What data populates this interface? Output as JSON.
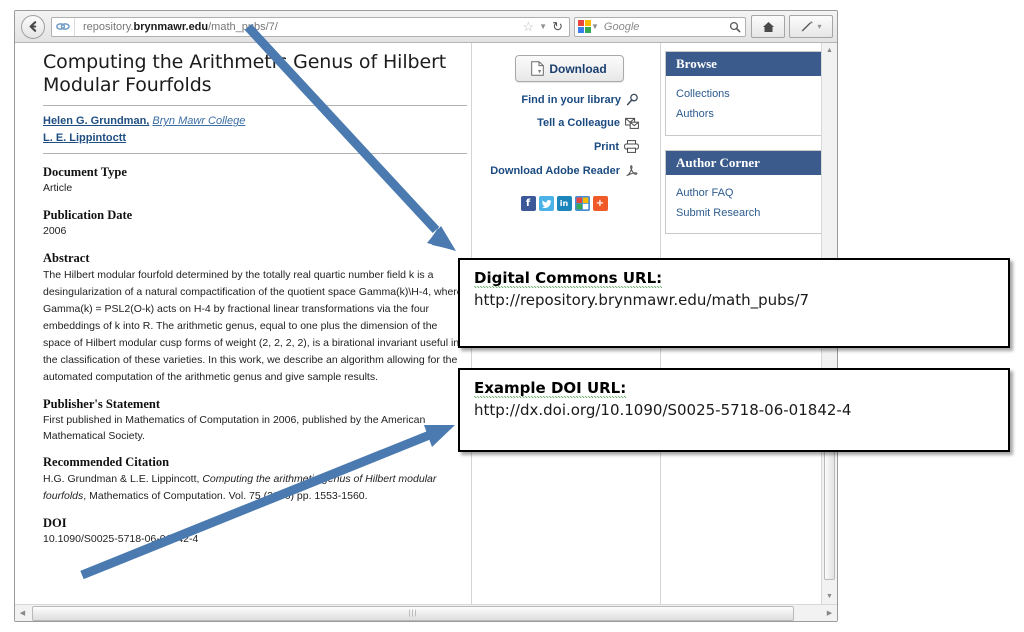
{
  "browser": {
    "url_prefix": "repository.",
    "url_domain": "brynmawr.edu",
    "url_path": "/math_pubs/7/",
    "back_icon": "back-arrow-icon",
    "site_icon": "link-icon",
    "bookmark_icon": "star-icon",
    "dropdown_icon": "chevron-down-icon",
    "reload_icon": "reload-icon",
    "search_engine": "Google",
    "search_placeholder": "Google",
    "search_icon": "magnifier-icon",
    "home_icon": "home-icon",
    "customize_icon": "pencil-icon",
    "split_caret": "▾"
  },
  "article": {
    "title": "Computing the Arithmetic Genus of Hilbert Modular Fourfolds",
    "authors": [
      {
        "name": "Helen G. Grundman,",
        "affiliation": "Bryn Mawr College"
      },
      {
        "name": "L. E. Lippintoctt",
        "affiliation": ""
      }
    ],
    "fields": [
      {
        "label": "Document Type",
        "value": "Article"
      },
      {
        "label": "Publication Date",
        "value": "2006"
      }
    ],
    "abstract_label": "Abstract",
    "abstract": "The Hilbert modular fourfold determined by the totally real quartic number field k is a desingularization of a natural compactification of the quotient space Gamma(k)\\H-4, where Gamma(k) = PSL2(O-k) acts on H-4 by fractional linear transformations via the four embeddings of k into R. The arithmetic genus, equal to one plus the dimension of the space of Hilbert modular cusp forms of weight (2, 2, 2, 2), is a birational invariant useful in the classification of these varieties. In this work, we describe an algorithm allowing for the automated computation of the arithmetic genus and give sample results.",
    "publisher_label": "Publisher's Statement",
    "publisher_statement": "First published in Mathematics of Computation in 2006, published by the American Mathematical Society.",
    "citation_label": "Recommended Citation",
    "citation_part1": "H.G. Grundman & L.E. Lippincott, ",
    "citation_italic": "Computing the arithmetic genus of Hilbert modular fourfolds",
    "citation_part2": ", Mathematics of Computation. Vol. 75 (2006) pp. 1553-1560.",
    "doi_label": "DOI",
    "doi_value": "10.1090/S0025-5718-06-01842-4"
  },
  "actions": {
    "download_label": "Download",
    "download_icon": "pdf-document-icon",
    "links": [
      {
        "label": "Find in your library",
        "icon": "magnifier-icon"
      },
      {
        "label": "Tell a Colleague",
        "icon": "envelope-icon"
      },
      {
        "label": "Print",
        "icon": "printer-icon"
      },
      {
        "label": "Download Adobe Reader",
        "icon": "adobe-reader-icon"
      }
    ],
    "social": [
      {
        "name": "facebook-icon",
        "glyph": "f",
        "color": "#3b5998"
      },
      {
        "name": "twitter-icon",
        "glyph": "t",
        "color": "#4cb3e8"
      },
      {
        "name": "linkedin-icon",
        "glyph": "in",
        "color": "#1b86bc"
      },
      {
        "name": "google-plus-icon",
        "glyph": "",
        "color": "#4a8ed6"
      },
      {
        "name": "addthis-icon",
        "glyph": "+",
        "color": "#f05a28"
      }
    ]
  },
  "sidebar": {
    "panels": [
      {
        "title": "Browse",
        "links": [
          "Collections",
          "Authors"
        ]
      },
      {
        "title": "Author Corner",
        "links": [
          "Author FAQ",
          "Submit Research"
        ]
      }
    ],
    "header_color": "#3b5b8c"
  },
  "annotations": {
    "arrow_color": "#4a7ab0",
    "callouts": [
      {
        "title": "Digital Commons URL:",
        "url": "http://repository.brynmawr.edu/math_pubs/7"
      },
      {
        "title": "Example DOI URL:",
        "url": "http://dx.doi.org/10.1090/S0025-5718-06-01842-4"
      }
    ]
  },
  "scroll": {
    "up_arrow": "▲",
    "down_arrow": "▼",
    "left_arrow": "◀",
    "right_arrow": "▶",
    "grip": "|||"
  }
}
